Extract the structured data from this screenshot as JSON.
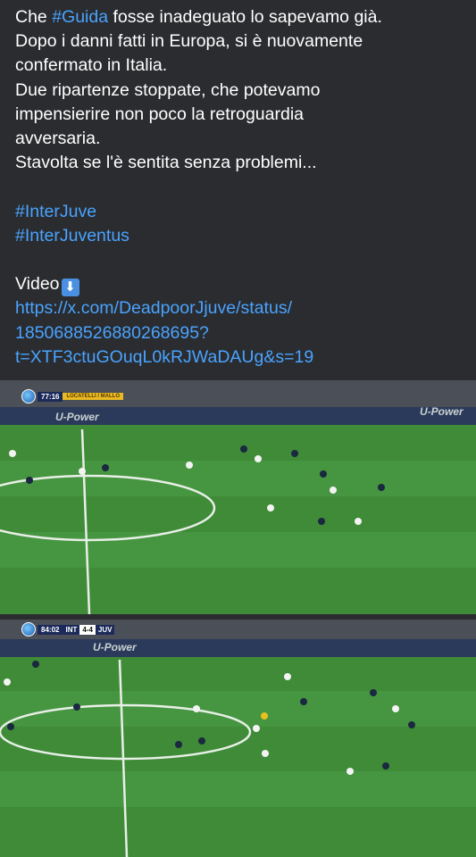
{
  "post": {
    "line1_prefix": "Che ",
    "line1_hashtag": "#Guida",
    "line1_suffix": " fosse inadeguato lo sapevamo già.",
    "line2": "Dopo i danni fatti in Europa, si è nuovamente",
    "line3": "confermato in Italia.",
    "line4": "Due ripartenze stoppate, che potevamo",
    "line5": "impensierire non poco la retroguardia",
    "line6": "avversaria.",
    "line7": "Stavolta se l'è sentita senza problemi...",
    "hashtag1": "#InterJuve",
    "hashtag2": "#InterJuventus",
    "video_label": "Video",
    "video_emoji": "⬇",
    "link_line1": "https://x.com/DeadpoorJjuve/status/",
    "link_line2": "1850688526880268695?",
    "link_line3": "t=XTF3ctuGOuqL0kRJWaDAUg&s=19"
  },
  "frames": [
    {
      "clock": "77:16",
      "player_caption": "LOCATELLI / MALLO",
      "board_text": "U-Power"
    },
    {
      "clock": "84:02",
      "home_team": "INT",
      "score": "4-4",
      "away_team": "JUV",
      "board_text": "U-Power"
    }
  ],
  "colors": {
    "background": "#2a2c2f",
    "text": "#ffffff",
    "link": "#4aa3ff",
    "pitch": "#3e8a36"
  }
}
